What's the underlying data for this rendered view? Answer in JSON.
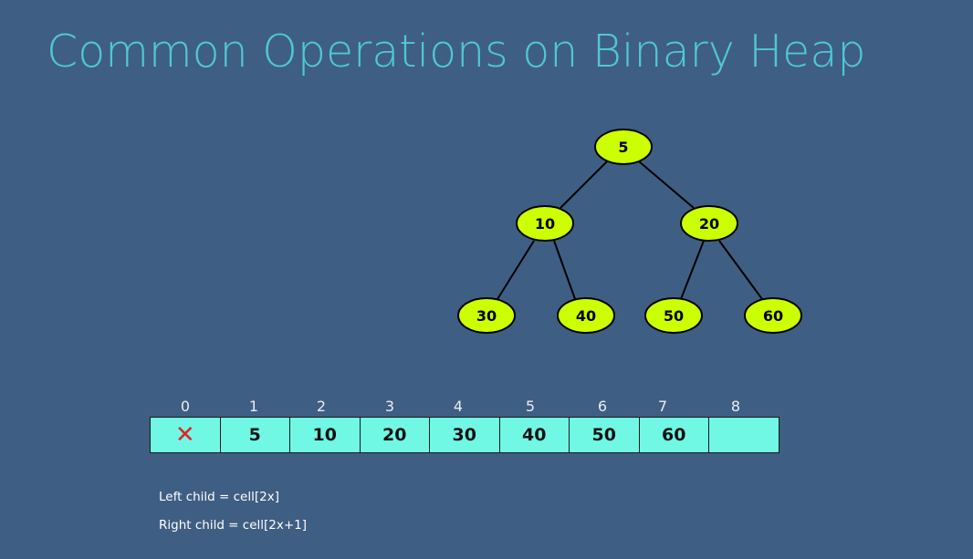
{
  "slide": {
    "title": "Common Operations on Binary Heap",
    "formulas": [
      "Left child = cell[2x]",
      "Right child = cell[2x+1]"
    ]
  },
  "tree": {
    "nodes": [
      "5",
      "10",
      "20",
      "30",
      "40",
      "50",
      "60"
    ],
    "edges": [
      [
        0,
        1
      ],
      [
        0,
        2
      ],
      [
        1,
        3
      ],
      [
        1,
        4
      ],
      [
        2,
        5
      ],
      [
        2,
        6
      ]
    ]
  },
  "array": {
    "indices": [
      "0",
      "1",
      "2",
      "3",
      "4",
      "5",
      "6",
      "7",
      "8"
    ],
    "cells": [
      "✕",
      "5",
      "10",
      "20",
      "30",
      "40",
      "50",
      "60",
      ""
    ]
  },
  "colors": {
    "background": "#3f5e83",
    "title": "#4fc8d6",
    "node": "#ccff00",
    "cell": "#70f8e5",
    "x_mark": "#e32222"
  }
}
